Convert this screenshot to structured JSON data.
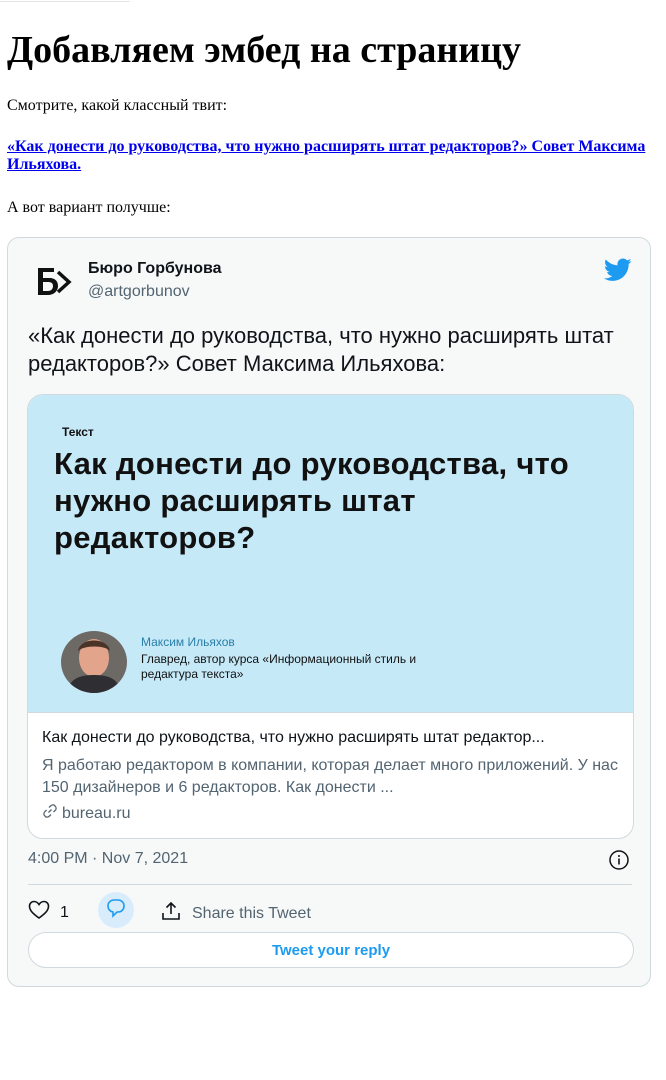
{
  "page": {
    "title": "Добавляем эмбед на страницу",
    "intro": "Смотрите, какой классный твит:",
    "link_text": "«Как донести до руководства, что нужно расширять штат редакторов?» Совет Максима Ильяхова.",
    "outro": "А вот вариант получше:"
  },
  "tweet": {
    "author_name": "Бюро Горбунова",
    "author_handle": "@artgorbunov",
    "text": "«Как донести до руководства, что нужно расширять штат редакторов?» Совет Максима Ильяхова:",
    "card": {
      "tag": "Текст",
      "heading": "Как донести до руководства, что нужно расширять штат редакторов?",
      "person_name": "Максим Ильяхов",
      "person_role": "Главред, автор курса «Информационный стиль и редактура текста»",
      "title": "Как донести до руководства, что нужно расширять штат редактор...",
      "description": "Я работаю редактором в компании, которая делает много приложений. У нас 150 дизайнеров и 6 редакторов. Как донести ...",
      "domain": "bureau.ru"
    },
    "timestamp": "4:00 PM · Nov 7, 2021",
    "like_count": "1",
    "share_label": "Share this Tweet",
    "reply_button": "Tweet your reply"
  },
  "colors": {
    "link": "#0000ee",
    "twitter_blue": "#1d9bf0",
    "card_bg": "#c6e9f8",
    "muted_text": "#536471"
  },
  "icons": [
    "bureau-logo-icon",
    "twitter-bird-icon",
    "link-icon",
    "info-icon",
    "heart-icon",
    "reply-bubble-icon",
    "share-icon"
  ]
}
